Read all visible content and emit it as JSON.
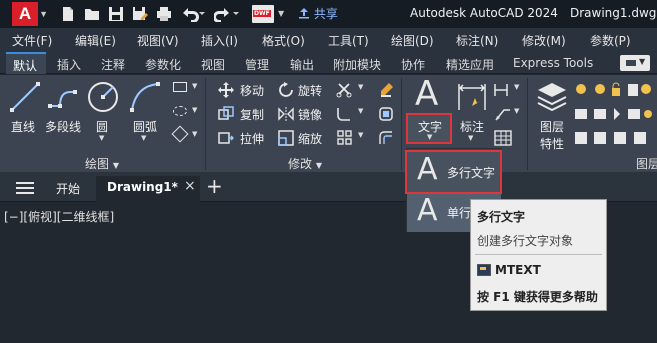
{
  "titlebar": {
    "logo": "A",
    "share": "共享",
    "app_name": "Autodesk AutoCAD 2024",
    "doc_name": "Drawing1.dwg",
    "dwf_badge": "DWF"
  },
  "menubar": [
    "文件(F)",
    "编辑(E)",
    "视图(V)",
    "插入(I)",
    "格式(O)",
    "工具(T)",
    "绘图(D)",
    "标注(N)",
    "修改(M)",
    "参数(P)"
  ],
  "ribbon_tabs": [
    "默认",
    "插入",
    "注释",
    "参数化",
    "视图",
    "管理",
    "输出",
    "附加模块",
    "协作",
    "精选应用",
    "Express Tools"
  ],
  "draw_panel": {
    "title": "绘图",
    "line": "直线",
    "polyline": "多段线",
    "circle": "圆",
    "arc": "圆弧"
  },
  "modify_panel": {
    "title": "修改",
    "move": "移动",
    "rotate": "旋转",
    "copy": "复制",
    "mirror": "镜像",
    "stretch": "拉伸",
    "scale": "缩放"
  },
  "annotation_panel": {
    "text": "文字",
    "dimension": "标注"
  },
  "layers_panel": {
    "properties_line1": "图层",
    "properties_line2": "特性",
    "title": "图层"
  },
  "file_tabs": {
    "start": "开始",
    "drawing": "Drawing1*",
    "add": "+"
  },
  "viewport_label": "[−][俯视][二维线框]",
  "dropdown": {
    "mtext": "多行文字",
    "single": "单行文字"
  },
  "tooltip": {
    "title": "多行文字",
    "desc": "创建多行文字对象",
    "command": "MTEXT",
    "help": "按 F1 键获得更多帮助"
  }
}
